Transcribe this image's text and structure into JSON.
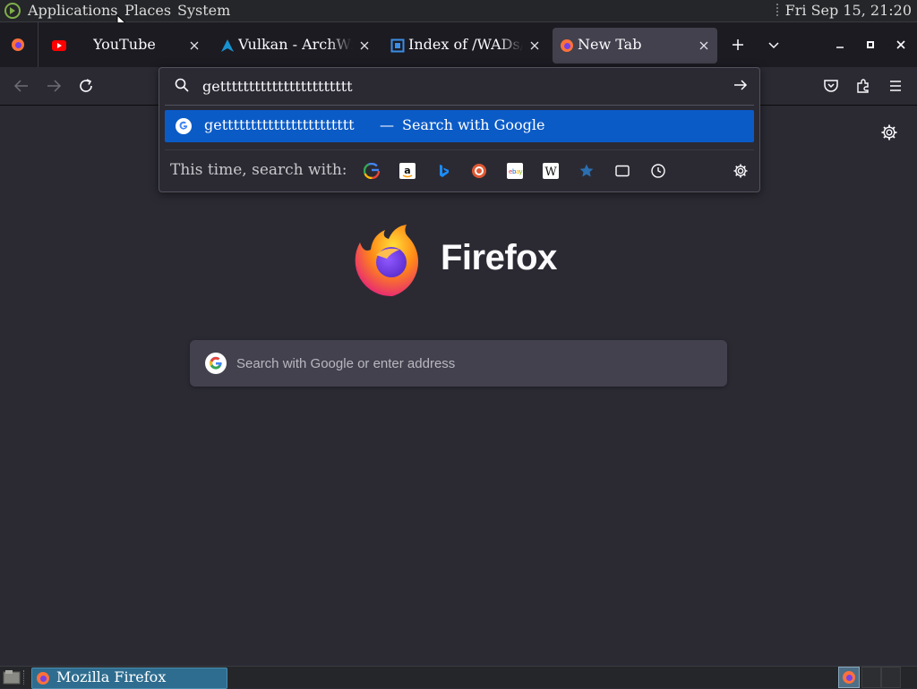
{
  "top_panel": {
    "menus": [
      "Applications",
      "Places",
      "System"
    ],
    "clock": "Fri Sep 15, 21:20"
  },
  "tabs": [
    {
      "label": "YouTube",
      "icon": "youtube-icon"
    },
    {
      "label": "Vulkan - ArchWiki",
      "icon": "arch-linux-icon"
    },
    {
      "label": "Index of /WADs/",
      "icon": "page-icon"
    },
    {
      "label": "New Tab",
      "icon": "firefox-icon",
      "active": true
    }
  ],
  "urlbar": {
    "value": "gettttttttttttttttttttttt",
    "suggestion": {
      "text": "gettttttttttttttttttttttt",
      "separator": "—",
      "action": "Search with Google"
    },
    "oneoff_label": "This time, search with:",
    "engines": [
      "google-icon",
      "amazon-icon",
      "bing-icon",
      "duckduckgo-icon",
      "ebay-icon",
      "wikipedia-icon",
      "bookmarks-icon",
      "tabs-icon",
      "history-icon"
    ]
  },
  "newtab": {
    "wordmark": "Firefox",
    "search_placeholder": "Search with Google or enter address"
  },
  "taskbar": {
    "window_label": "Mozilla Firefox"
  },
  "colors": {
    "page_bg": "#2b2a33",
    "tabbar_bg": "#1c1b22",
    "selected_suggestion": "#0b5bc7",
    "search_box": "#42414d"
  }
}
